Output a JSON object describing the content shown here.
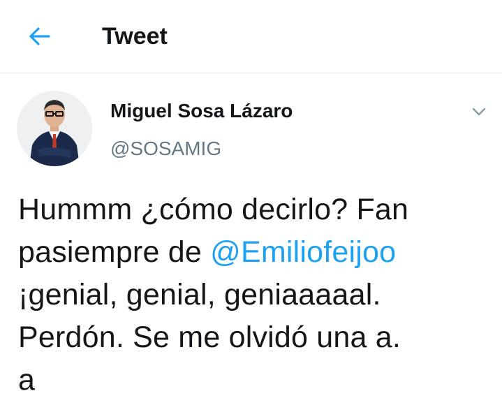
{
  "header": {
    "back_icon": "arrow-left-icon",
    "title": "Tweet",
    "accent_color": "#1da1f2"
  },
  "tweet": {
    "author": {
      "name": "Miguel Sosa Lázaro",
      "handle": "@SOSAMIG",
      "avatar": "profile-photo"
    },
    "menu_icon": "chevron-down-icon",
    "body": {
      "line1": "Hummm ¿cómo decirlo? Fan",
      "line2_prefix": "pasiempre de ",
      "mention": "@Emiliofeijoo",
      "line3": "¡genial, genial, geniaaaaal.",
      "line4": "Perdón. Se me olvidó una a.",
      "line5": "a"
    }
  },
  "colors": {
    "text": "#14171a",
    "secondary": "#657786",
    "link": "#1da1f2",
    "divider": "#e1e8ed"
  }
}
